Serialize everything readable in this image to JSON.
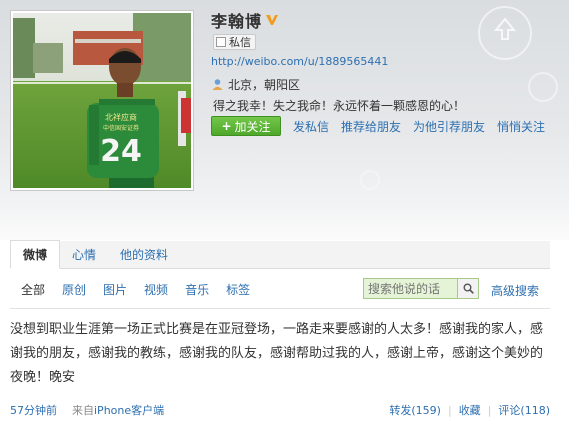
{
  "profile": {
    "name": "李翰博",
    "message_button": "私信",
    "url": "http://weibo.com/u/1889565441",
    "location": "北京，朝阳区",
    "bio": "得之我幸！失之我命！永远怀着一颗感恩的心！",
    "jersey_text": "北祥应商",
    "jersey_sub": "中信国安证券",
    "jersey_number": "24"
  },
  "actions": {
    "follow": "加关注",
    "send_message": "发私信",
    "recommend": "推荐给朋友",
    "introduce": "为他引荐朋友",
    "quiet_follow": "悄悄关注"
  },
  "tabs": [
    "微博",
    "心情",
    "他的资料"
  ],
  "filters": [
    "全部",
    "原创",
    "图片",
    "视频",
    "音乐",
    "标签"
  ],
  "search": {
    "placeholder": "搜索他说的话",
    "advanced": "高级搜索"
  },
  "post": {
    "text": "没想到职业生涯第一场正式比赛是在亚冠登场，一路走来要感谢的人太多！感谢我的家人，感谢我的朋友，感谢我的教练，感谢我的队友，感谢帮助过我的人，感谢上帝，感谢这个美妙的夜晚！晚安",
    "time": "57分钟前",
    "source_prefix": "来自",
    "source": "iPhone客户端",
    "repost": "转发(159)",
    "favorite": "收藏",
    "comment": "评论(118)"
  },
  "colors": {
    "link": "#2d6fb0",
    "follow_button": "#5cb535",
    "verified_badge": "#f29c1f",
    "search_bg": "#e5f3d6"
  },
  "icons": {
    "verified": "verified-v-icon",
    "message": "mail-box-icon",
    "location": "person-location-icon",
    "search": "magnifier-icon"
  }
}
